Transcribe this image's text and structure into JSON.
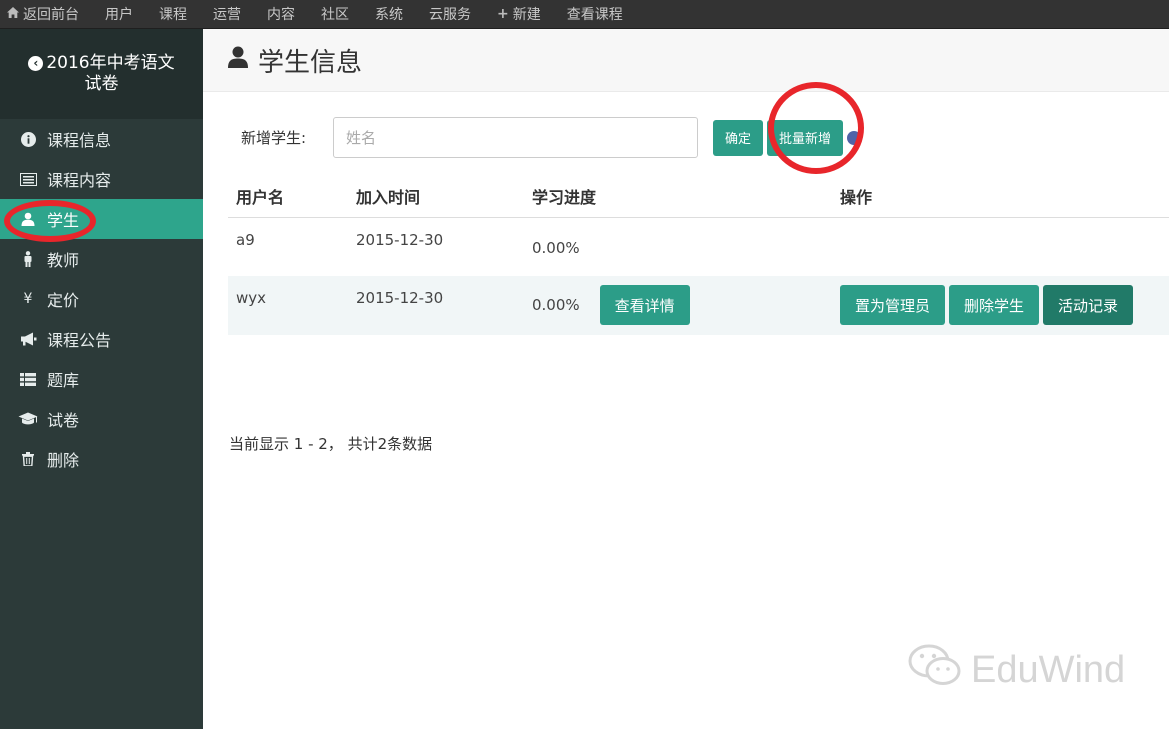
{
  "topnav": {
    "items": [
      {
        "icon": "home-icon",
        "label": "返回前台"
      },
      {
        "label": "用户"
      },
      {
        "label": "课程"
      },
      {
        "label": "运营"
      },
      {
        "label": "内容"
      },
      {
        "label": "社区"
      },
      {
        "label": "系统"
      },
      {
        "label": "云服务"
      },
      {
        "icon": "plus-icon",
        "label": "新建"
      },
      {
        "label": "查看课程"
      }
    ]
  },
  "sidebar": {
    "course_title": "2016年中考语文试卷",
    "items": [
      {
        "icon": "info-icon",
        "label": "课程信息"
      },
      {
        "icon": "list-icon",
        "label": "课程内容"
      },
      {
        "icon": "user-icon",
        "label": "学生",
        "active": true
      },
      {
        "icon": "person-icon",
        "label": "教师"
      },
      {
        "icon": "yen-icon",
        "label": "定价"
      },
      {
        "icon": "bullhorn-icon",
        "label": "课程公告"
      },
      {
        "icon": "table-icon",
        "label": "题库"
      },
      {
        "icon": "graduation-cap-icon",
        "label": "试卷"
      },
      {
        "icon": "trash-icon",
        "label": "删除"
      }
    ]
  },
  "page": {
    "title": "学生信息"
  },
  "add_student": {
    "label": "新增学生:",
    "placeholder": "姓名",
    "confirm": "确定",
    "batch_add": "批量新增"
  },
  "table": {
    "headers": [
      "用户名",
      "加入时间",
      "学习进度",
      "操作"
    ],
    "rows": [
      {
        "username": "a9",
        "joined": "2015-12-30",
        "progress": "0.00%"
      },
      {
        "username": "wyx",
        "joined": "2015-12-30",
        "progress": "0.00%",
        "detail": "查看详情",
        "actions": [
          "置为管理员",
          "删除学生",
          "活动记录"
        ]
      }
    ]
  },
  "pager": {
    "info": "当前显示 1 - 2， 共计2条数据"
  },
  "watermark": {
    "text": "EduWind"
  },
  "colors": {
    "accent": "#2c9d88",
    "sidebar": "#2c3a39",
    "highlight": "#e8262b"
  }
}
